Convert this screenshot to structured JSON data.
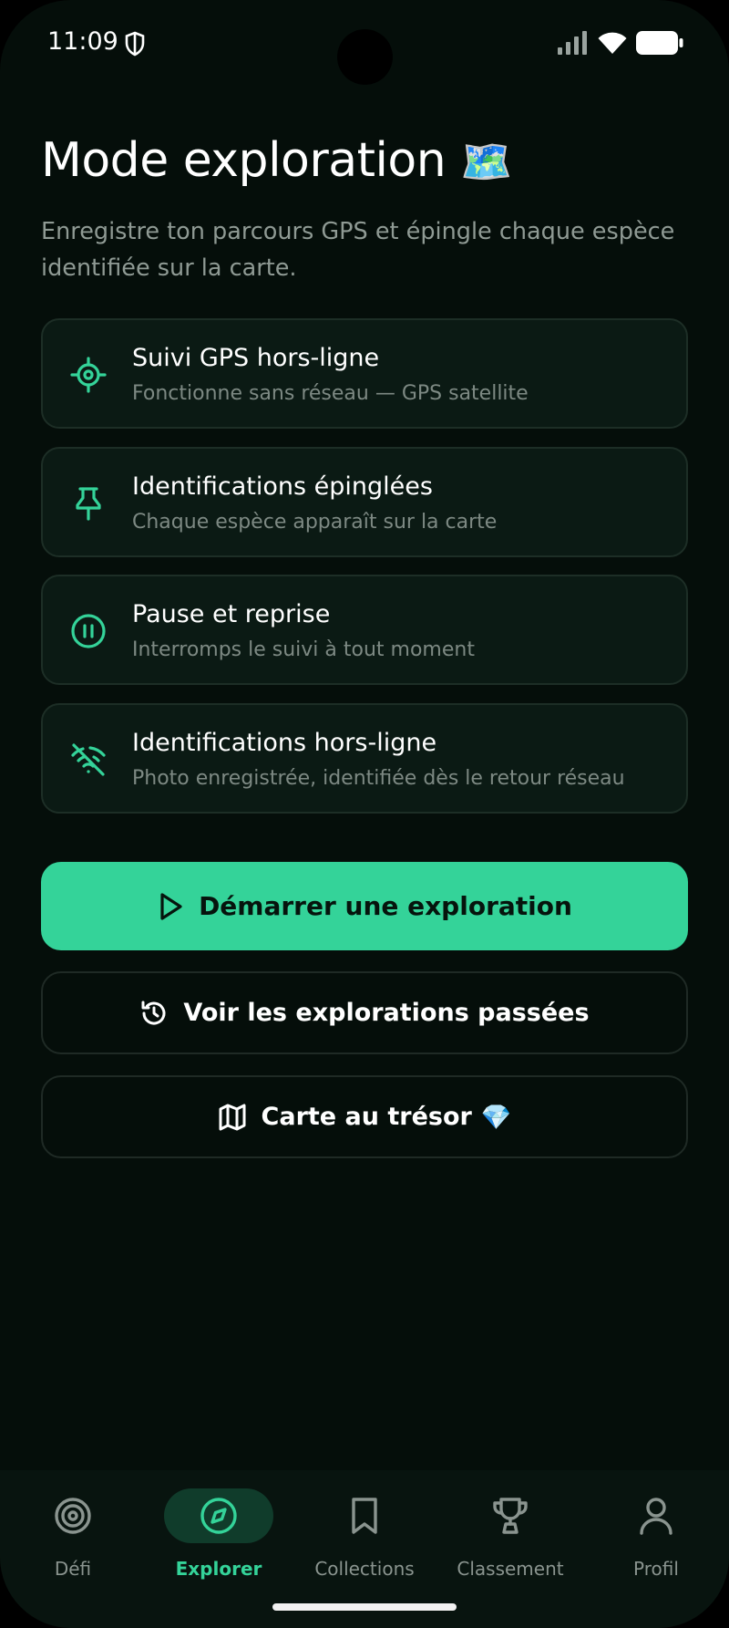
{
  "status_bar": {
    "time": "11:09"
  },
  "header": {
    "title": "Mode exploration",
    "title_emoji": "🗺️",
    "subtitle": "Enregistre ton parcours GPS et épingle chaque espèce identifiée sur la carte."
  },
  "features": [
    {
      "icon": "target-icon",
      "title": "Suivi GPS hors-ligne",
      "subtitle": "Fonctionne sans réseau — GPS satellite"
    },
    {
      "icon": "pin-icon",
      "title": "Identifications épinglées",
      "subtitle": "Chaque espèce apparaît sur la carte"
    },
    {
      "icon": "pause-icon",
      "title": "Pause et reprise",
      "subtitle": "Interromps le suivi à tout moment"
    },
    {
      "icon": "wifi-off-icon",
      "title": "Identifications hors-ligne",
      "subtitle": "Photo enregistrée, identifiée dès le retour réseau"
    }
  ],
  "actions": {
    "start": "Démarrer une exploration",
    "history": "Voir les explorations passées",
    "treasure": "Carte au trésor",
    "treasure_emoji": "💎"
  },
  "nav": {
    "items": [
      {
        "label": "Défi",
        "icon": "target-icon"
      },
      {
        "label": "Explorer",
        "icon": "compass-icon"
      },
      {
        "label": "Collections",
        "icon": "bookmark-icon"
      },
      {
        "label": "Classement",
        "icon": "trophy-icon"
      },
      {
        "label": "Profil",
        "icon": "user-icon"
      }
    ],
    "active": "Explorer"
  },
  "colors": {
    "accent": "#34d399",
    "background": "#050e0a",
    "card": "#0b1a14"
  }
}
